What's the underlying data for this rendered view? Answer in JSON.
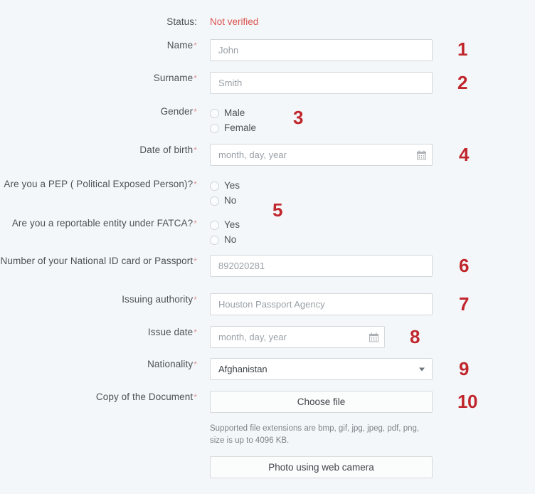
{
  "form": {
    "status": {
      "label": "Status:",
      "value": "Not verified"
    },
    "fields": [
      {
        "id": "name",
        "label": "Name",
        "required": "*",
        "type": "text",
        "value": "John",
        "marker": "1"
      },
      {
        "id": "surname",
        "label": "Surname",
        "required": "*",
        "type": "text",
        "value": "Smith",
        "marker": "2"
      },
      {
        "id": "gender",
        "label": "Gender",
        "required": "*",
        "type": "radio",
        "options": [
          "Male",
          "Female"
        ],
        "marker": "3"
      },
      {
        "id": "date-of-birth",
        "label": "Date of birth",
        "required": "*",
        "type": "date",
        "value": "month, day, year",
        "marker": "4"
      },
      {
        "id": "pep",
        "label": "Are you a PEP ( Political Exposed Person)?",
        "required": "*",
        "type": "radio",
        "options": [
          "Yes",
          "No"
        ],
        "marker": "5"
      },
      {
        "id": "fatca",
        "label": "Are you a reportable entity under FATCA?",
        "required": "*",
        "type": "radio",
        "options": [
          "Yes",
          "No"
        ]
      },
      {
        "id": "document-number",
        "label": "Number of your National ID card or Passport",
        "required": "*",
        "type": "text",
        "value": "892020281",
        "marker": "6"
      },
      {
        "id": "issuing-authority",
        "label": "Issuing authority",
        "required": "*",
        "type": "text",
        "value": "Houston Passport Agency",
        "marker": "7"
      },
      {
        "id": "issue-date",
        "label": "Issue date",
        "required": "*",
        "type": "date",
        "value": "month, day, year",
        "marker": "8"
      },
      {
        "id": "nationality",
        "label": "Nationality",
        "required": "*",
        "type": "select",
        "value": "Afghanistan",
        "marker": "9"
      },
      {
        "id": "copy-of-document",
        "label": "Copy of the Document",
        "required": "*",
        "type": "file",
        "button_label": "Choose file",
        "marker": "10"
      }
    ],
    "file_helper": "Supported file extensions are bmp, gif, jpg, jpeg, pdf, png, size is up to 4096 KB.",
    "webcam_button": "Photo using web camera"
  },
  "colors": {
    "background": "#f4f7f9",
    "marker_red": "#c0272d",
    "status_red": "#d9534f",
    "label_text": "#4c5156",
    "placeholder": "#9aa0a6",
    "input_border": "#d3d8dc"
  }
}
